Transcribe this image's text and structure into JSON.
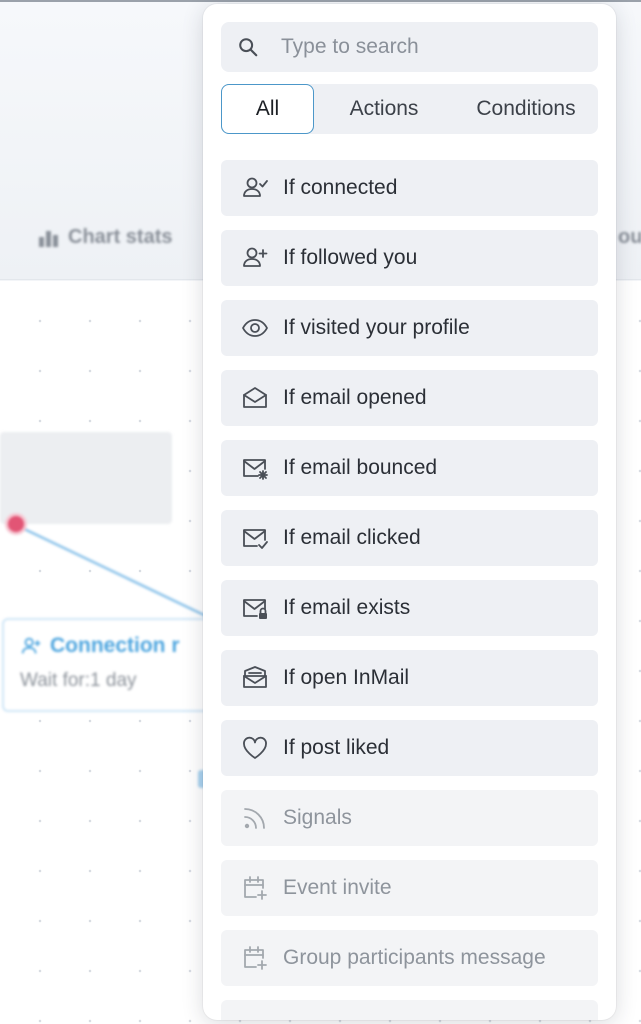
{
  "background": {
    "toolbar_item_left": "",
    "chart_stats_label": "Chart stats",
    "toolbar_item_right": "ou",
    "node": {
      "title": "Connection r",
      "subtitle": "Wait for:1 day"
    }
  },
  "dropdown": {
    "search": {
      "placeholder": "Type to search",
      "value": "",
      "icon": "search-icon"
    },
    "tabs": [
      {
        "label": "All",
        "selected": true
      },
      {
        "label": "Actions",
        "selected": false
      },
      {
        "label": "Conditions",
        "selected": false
      }
    ],
    "items": [
      {
        "label": "If connected",
        "icon": "user-check-icon",
        "enabled": true
      },
      {
        "label": "If followed you",
        "icon": "user-plus-icon",
        "enabled": true
      },
      {
        "label": "If visited your profile",
        "icon": "eye-icon",
        "enabled": true
      },
      {
        "label": "If email opened",
        "icon": "envelope-open-icon",
        "enabled": true
      },
      {
        "label": "If email bounced",
        "icon": "envelope-bounce-icon",
        "enabled": true
      },
      {
        "label": "If email clicked",
        "icon": "envelope-check-icon",
        "enabled": true
      },
      {
        "label": "If email exists",
        "icon": "envelope-lock-icon",
        "enabled": true
      },
      {
        "label": "If open InMail",
        "icon": "inmail-icon",
        "enabled": true
      },
      {
        "label": "If post liked",
        "icon": "heart-icon",
        "enabled": true
      },
      {
        "label": "Signals",
        "icon": "rss-icon",
        "enabled": false
      },
      {
        "label": "Event invite",
        "icon": "calendar-plus-icon",
        "enabled": false
      },
      {
        "label": "Group participants message",
        "icon": "calendar-plus-icon",
        "enabled": false
      }
    ]
  },
  "colors": {
    "accent_border": "#4c97c9",
    "node_title": "#4fa6df",
    "node_dot": "#e25575",
    "item_bg": "#eef0f4"
  }
}
